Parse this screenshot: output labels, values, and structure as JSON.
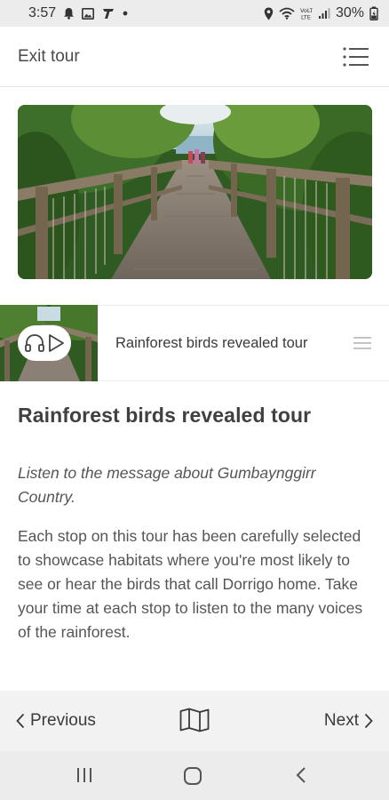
{
  "status_bar": {
    "time": "3:57",
    "battery": "30%",
    "icons": [
      "notification-bell-icon",
      "gallery-icon",
      "telstra-icon",
      "dot-icon",
      "location-icon",
      "wifi-icon",
      "volte-icon",
      "signal-icon",
      "battery-icon"
    ]
  },
  "header": {
    "exit_label": "Exit tour",
    "menu_icon": "list-menu-icon"
  },
  "audio": {
    "title": "Rainforest birds revealed tour",
    "play_icons": [
      "headphones-icon",
      "play-icon"
    ],
    "handle_icon": "drag-handle-icon"
  },
  "content": {
    "title": "Rainforest birds revealed tour",
    "intro": "Listen to the message about Gumbaynggirr Country.",
    "description": "Each stop on this tour has been carefully selected to showcase habitats where you're most likely to see or hear the birds that call Dorrigo home. Take your time at each stop to listen to the many voices of the rainforest."
  },
  "bottom_nav": {
    "previous_label": "Previous",
    "next_label": "Next",
    "map_icon": "map-icon"
  },
  "system_nav": {
    "icons": [
      "recent-apps-icon",
      "home-icon",
      "back-icon"
    ]
  },
  "colors": {
    "text": "#3a3a3a",
    "status_bar_bg": "#ececec",
    "bottom_nav_bg": "#f2f2f2"
  }
}
